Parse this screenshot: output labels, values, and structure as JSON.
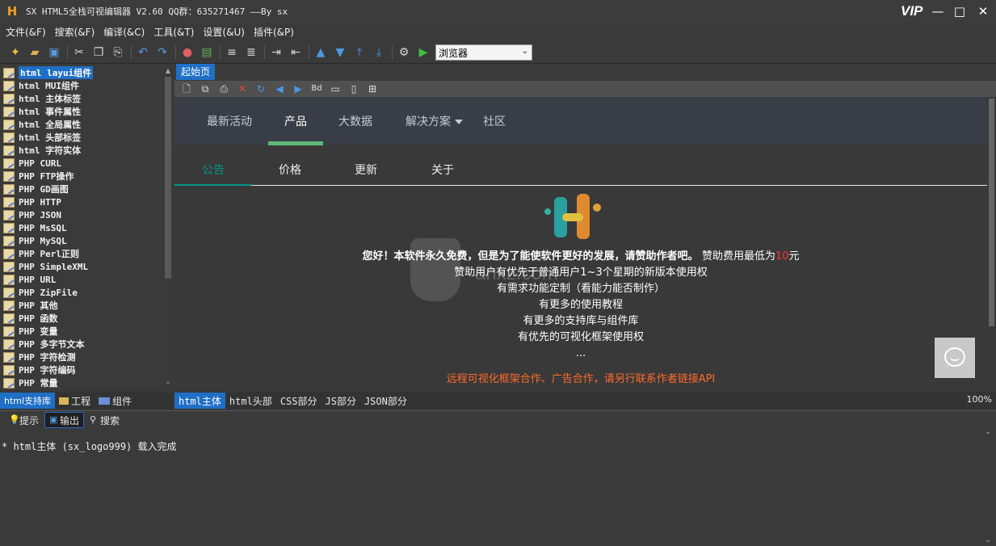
{
  "window": {
    "title": "SX HTML5全栈可视编辑器 V2.60 QQ群：635271467 ——By sx",
    "vip_label": "VIP",
    "minimize": "—",
    "maximize": "□",
    "close": "✕"
  },
  "menu": [
    "文件(&F)",
    "搜索(&F)",
    "编译(&C)",
    "工具(&T)",
    "设置(&U)",
    "插件(&P)"
  ],
  "toolbar": {
    "browser_select": "浏览器"
  },
  "tree": {
    "items": [
      "html layui组件",
      "html MUI组件",
      "html 主体标签",
      "html 事件属性",
      "html 全局属性",
      "html 头部标签",
      "html 字符实体",
      "PHP CURL",
      "PHP FTP操作",
      "PHP GD画图",
      "PHP HTTP",
      "PHP JSON",
      "PHP MsSQL",
      "PHP MySQL",
      "PHP Perl正则",
      "PHP SimpleXML",
      "PHP URL",
      "PHP ZipFile",
      "PHP 其他",
      "PHP 函数",
      "PHP 变量",
      "PHP 多字节文本",
      "PHP 字符检测",
      "PHP 字符编码",
      "PHP 常量"
    ],
    "selected_index": 0
  },
  "left_tabs": [
    "html支持库",
    "工程",
    "组件"
  ],
  "doc_tab": "起始页",
  "preview": {
    "nav": [
      "最新活动",
      "产品",
      "大数据",
      "解决方案",
      "社区"
    ],
    "subtabs": [
      "公告",
      "价格",
      "更新",
      "关于"
    ],
    "line1_bold": "您好！本软件永久免费，但是为了能使软件更好的发展，请赞助作者吧。",
    "line1_normal": "赞助费用最低为",
    "line1_amount": "10",
    "line1_unit": "元",
    "line2": "赞助用户有优先于普通用户1~3个星期的新版本使用权",
    "line3": "有需求功能定制（看能力能否制作）",
    "line4": "有更多的使用教程",
    "line5": "有更多的支持库与组件库",
    "line6": "有优先的可视化框架使用权",
    "line7": "...",
    "footer_note": "远程可视化框架合作、广告合作，请另行联系作者链接API",
    "watermark": "anxz.com"
  },
  "editor_tabs": [
    "html主体",
    "html头部",
    "CSS部分",
    "JS部分",
    "JSON部分"
  ],
  "zoom": "100%",
  "output_tabs": [
    "提示",
    "输出",
    "搜索"
  ],
  "output_text": "* html主体 (sx_logo999) 载入完成",
  "colors": {
    "accent_blue": "#1f6fc6",
    "nav_green": "#5fb878",
    "teal": "#009688",
    "orange_text": "#ff6a2a"
  }
}
